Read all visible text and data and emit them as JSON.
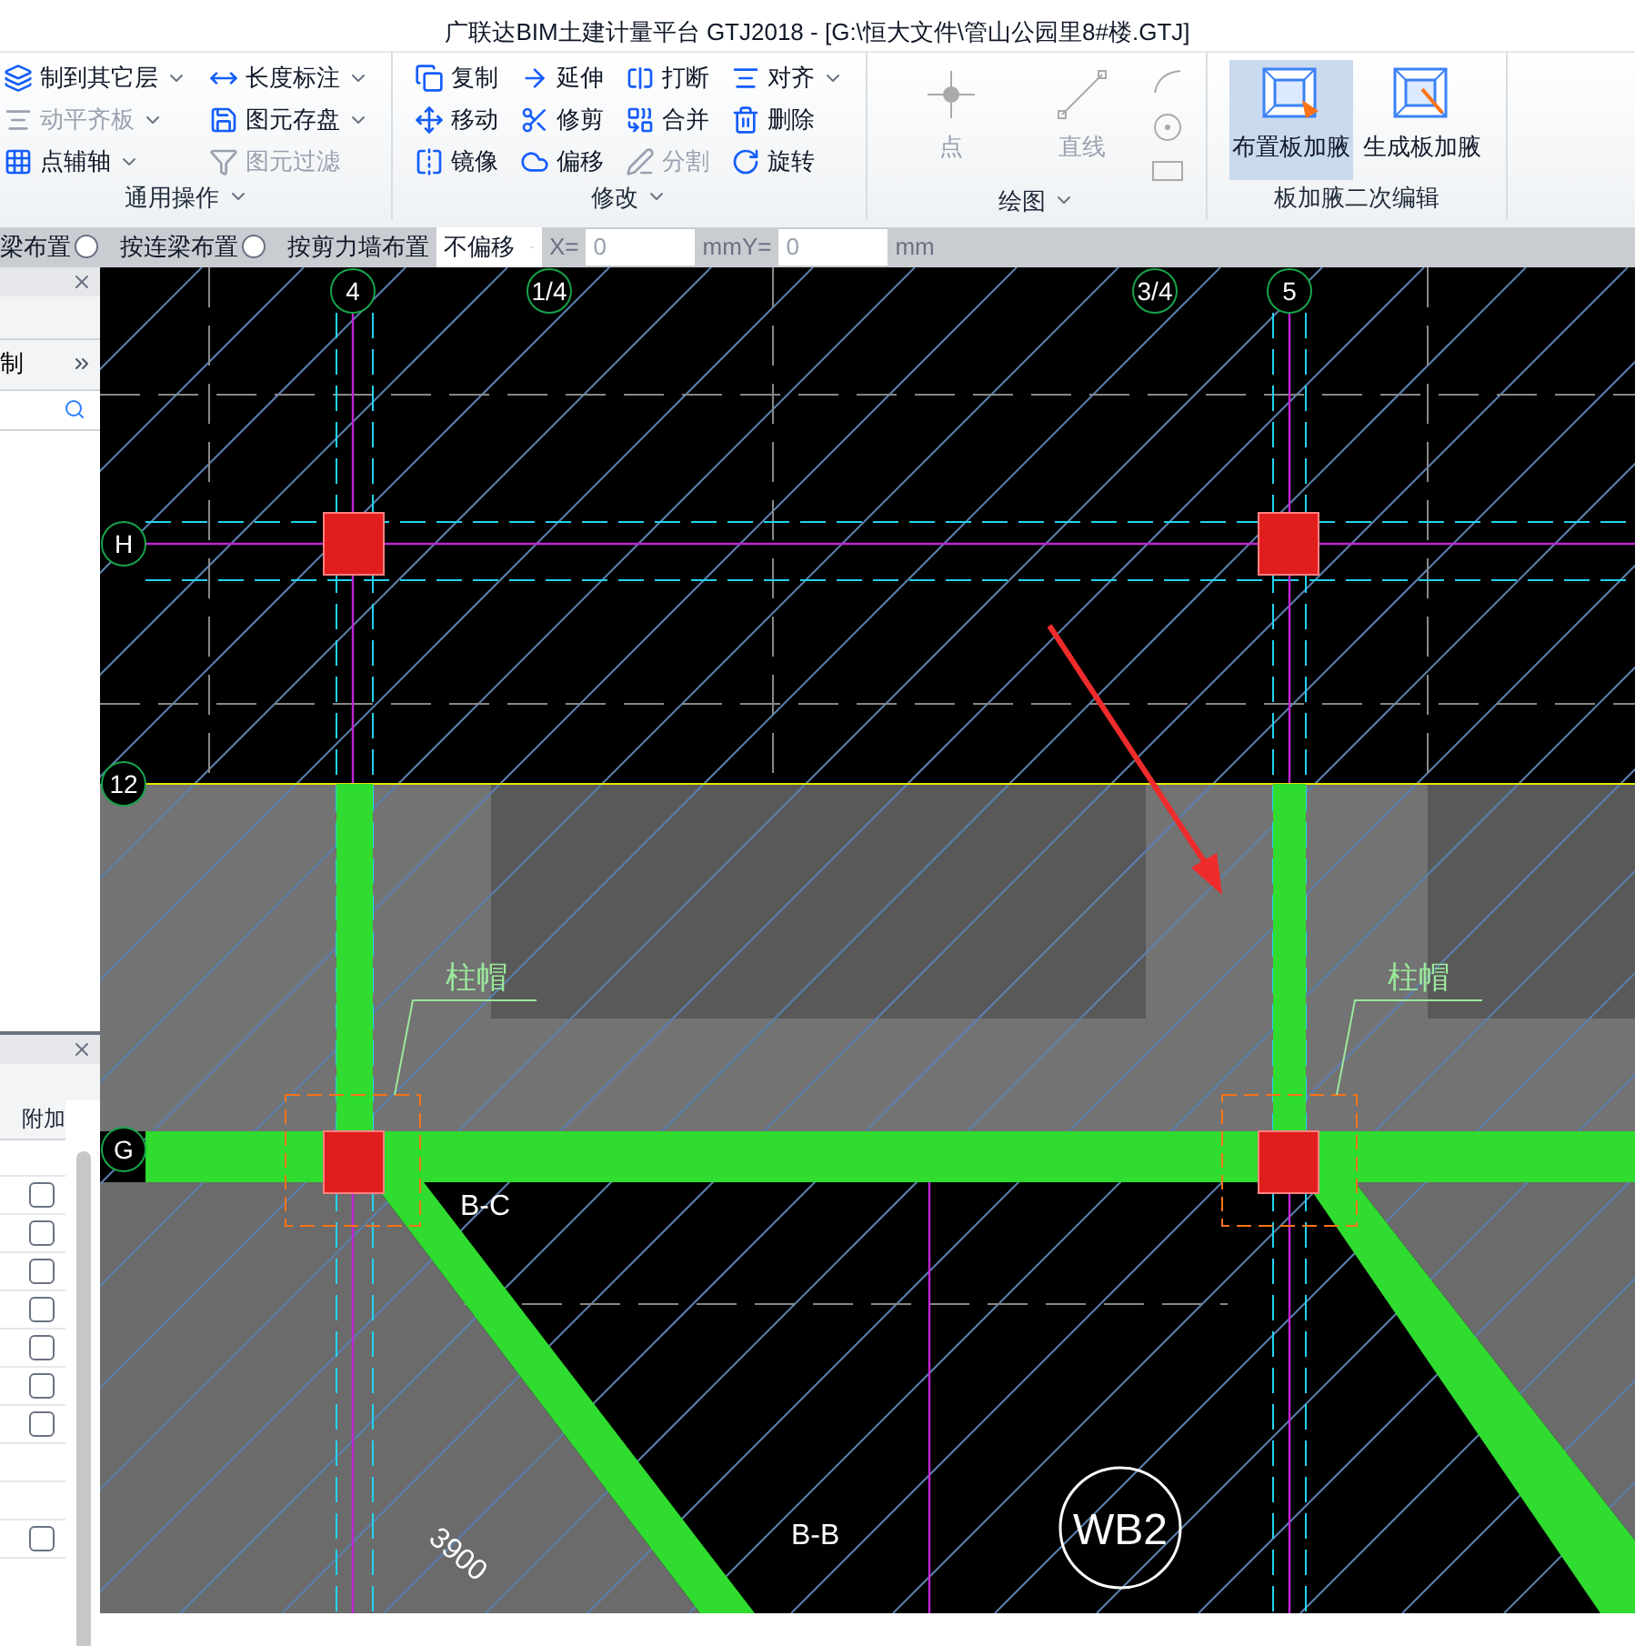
{
  "window": {
    "title": "广联达BIM土建计量平台 GTJ2018 - [G:\\恒大文件\\管山公园里8#楼.GTJ]"
  },
  "ribbon": {
    "groups": [
      {
        "kind": "small",
        "label": "通用操作",
        "dropdown": true,
        "columns": [
          [
            {
              "label": "制到其它层",
              "dropdown": true,
              "disabled": false
            },
            {
              "label": "动平齐板",
              "dropdown": true,
              "disabled": true
            },
            {
              "label": "点辅轴",
              "dropdown": true,
              "disabled": false
            }
          ],
          [
            {
              "label": "长度标注",
              "dropdown": true,
              "disabled": false
            },
            {
              "label": "图元存盘",
              "dropdown": true,
              "disabled": false
            },
            {
              "label": "图元过滤",
              "dropdown": false,
              "disabled": true
            }
          ]
        ]
      },
      {
        "kind": "small",
        "label": "修改",
        "dropdown": true,
        "columns": [
          [
            {
              "label": "复制",
              "dropdown": false,
              "disabled": false
            },
            {
              "label": "移动",
              "dropdown": false,
              "disabled": false
            },
            {
              "label": "镜像",
              "dropdown": false,
              "disabled": false
            }
          ],
          [
            {
              "label": "延伸",
              "dropdown": false,
              "disabled": false
            },
            {
              "label": "修剪",
              "dropdown": false,
              "disabled": false
            },
            {
              "label": "偏移",
              "dropdown": false,
              "disabled": false
            }
          ],
          [
            {
              "label": "打断",
              "dropdown": false,
              "disabled": false
            },
            {
              "label": "合并",
              "dropdown": false,
              "disabled": false
            },
            {
              "label": "分割",
              "dropdown": false,
              "disabled": true
            }
          ],
          [
            {
              "label": "对齐",
              "dropdown": true,
              "disabled": false
            },
            {
              "label": "删除",
              "dropdown": false,
              "disabled": false
            },
            {
              "label": "旋转",
              "dropdown": false,
              "disabled": false
            }
          ]
        ]
      },
      {
        "kind": "draw",
        "label": "绘图",
        "dropdown": true,
        "buttons": [
          {
            "label": "点",
            "selected": false,
            "disabled": true
          },
          {
            "label": "直线",
            "selected": false,
            "disabled": true
          }
        ]
      },
      {
        "kind": "large",
        "label": "板加腋二次编辑",
        "dropdown": false,
        "buttons": [
          {
            "label": "布置板加腋",
            "selected": true,
            "disabled": false
          },
          {
            "label": "生成板加腋",
            "selected": false,
            "disabled": false
          }
        ]
      }
    ]
  },
  "options_bar": {
    "radios": [
      {
        "label": "梁布置",
        "selected": false
      },
      {
        "label": "按连梁布置",
        "selected": false
      }
    ],
    "label": "按剪力墙布置",
    "offset_select": "不偏移",
    "x_label": "X=",
    "x_value": "0",
    "x_unit": "mm",
    "y_label": "Y=",
    "y_value": "0",
    "y_unit": "mm"
  },
  "left_panel_top": {
    "menu_item": "制"
  },
  "left_panel_bottom": {
    "column": "附加",
    "rows": [
      {
        "kind": "checkbox",
        "checked": false
      },
      {
        "kind": "checkbox",
        "checked": false
      },
      {
        "kind": "checkbox",
        "checked": false
      },
      {
        "kind": "checkbox",
        "checked": false
      },
      {
        "kind": "checkbox",
        "checked": false
      },
      {
        "kind": "checkbox",
        "checked": false
      },
      {
        "kind": "checkbox",
        "checked": false
      },
      {
        "kind": "empty"
      },
      {
        "kind": "empty"
      },
      {
        "kind": "checkbox",
        "checked": false
      }
    ]
  },
  "canvas": {
    "top_axes": [
      {
        "label": "4"
      },
      {
        "label": "1/4"
      },
      {
        "label": "3/4"
      },
      {
        "label": "5"
      }
    ],
    "side_axes": [
      {
        "label": "H"
      },
      {
        "label": "12"
      },
      {
        "label": "G"
      }
    ],
    "labels": [
      {
        "kind": "cap",
        "text": "柱帽"
      },
      {
        "kind": "cap",
        "text": "柱帽"
      },
      {
        "kind": "beam",
        "text": "B-C"
      },
      {
        "kind": "beam",
        "text": "B-B"
      },
      {
        "kind": "slab",
        "text": "WB2"
      },
      {
        "kind": "dimension",
        "text": "3900"
      }
    ]
  }
}
